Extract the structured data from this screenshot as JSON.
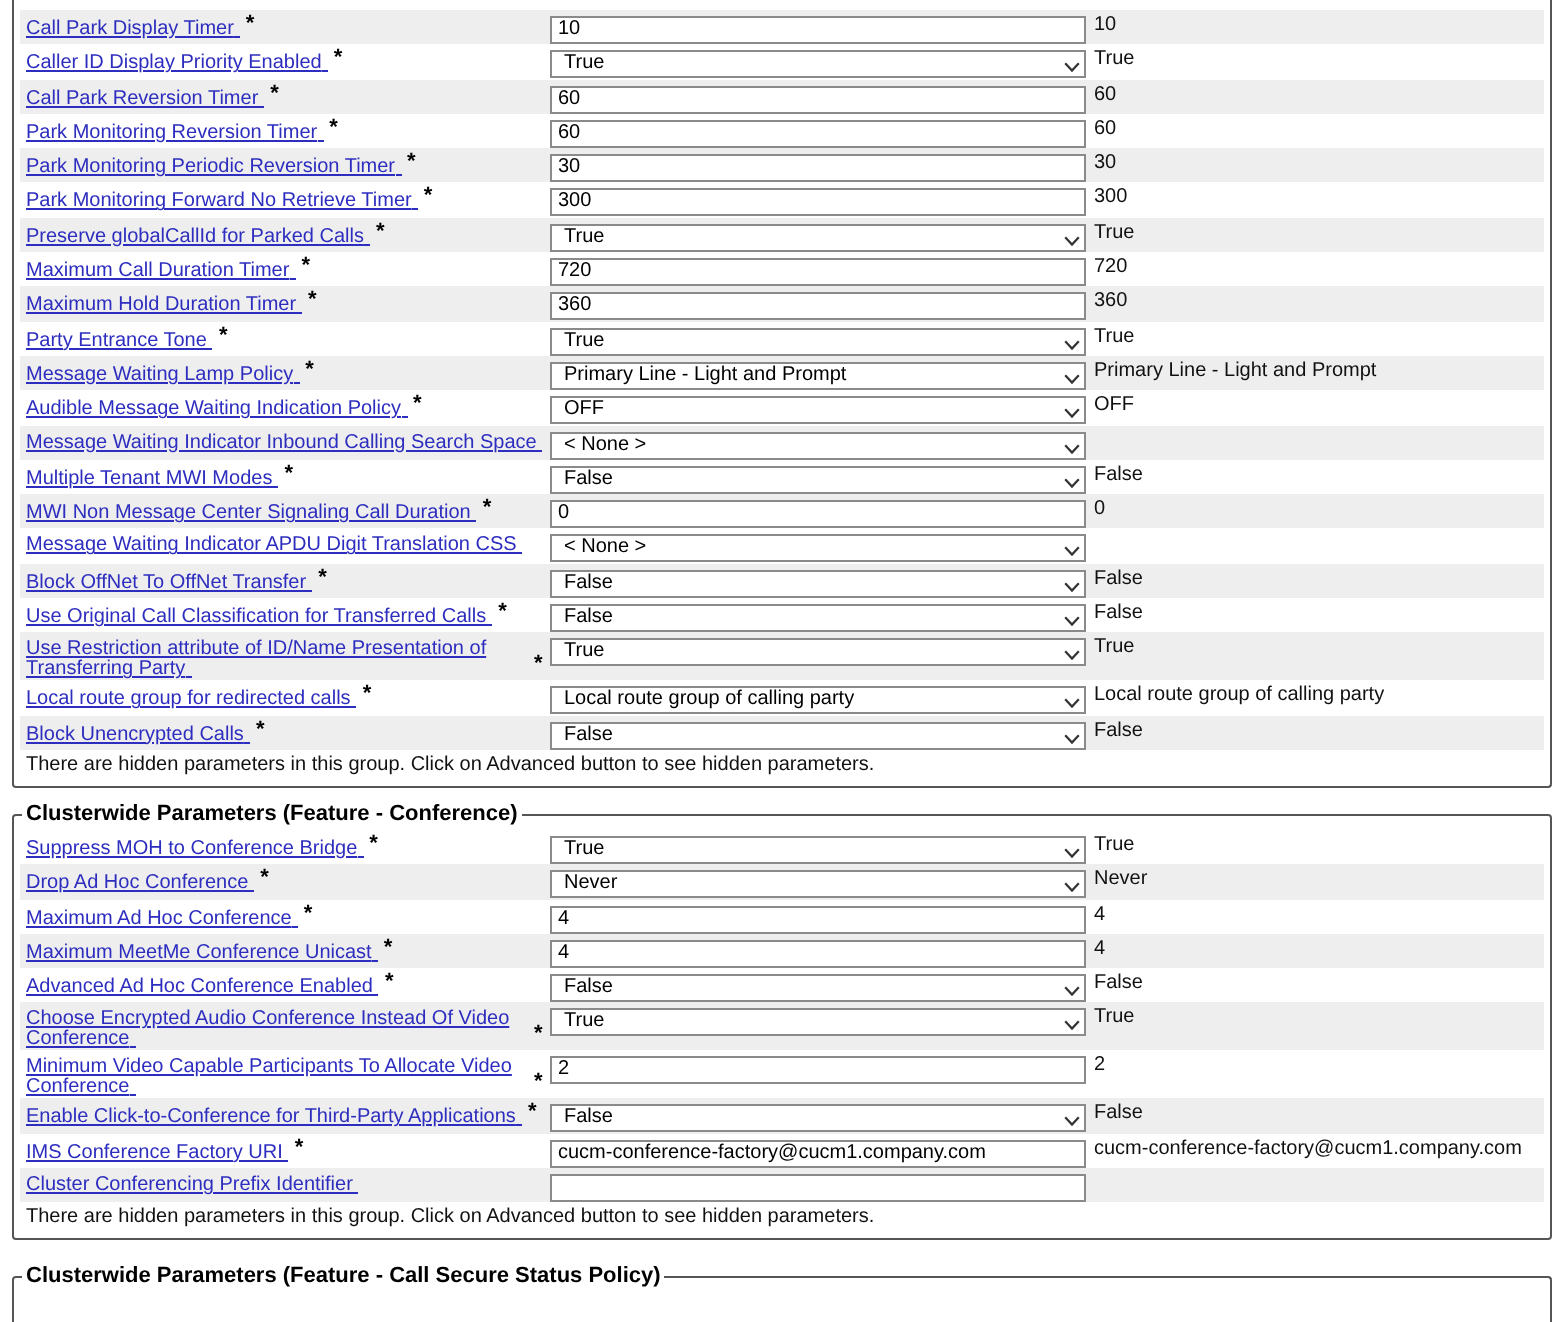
{
  "sections": [
    {
      "rows": [
        {
          "label": "Call Park Display Timer",
          "required_mark": "*",
          "field": {
            "kind": "text",
            "value": "10"
          },
          "column_3": "10"
        },
        {
          "label": "Caller ID Display Priority Enabled",
          "required_mark": "*",
          "field": {
            "kind": "select",
            "value": "True"
          },
          "column_3": "True"
        },
        {
          "label": "Call Park Reversion Timer",
          "required_mark": "*",
          "field": {
            "kind": "text",
            "value": "60"
          },
          "column_3": "60"
        },
        {
          "label": "Park Monitoring Reversion Timer",
          "required_mark": "*",
          "field": {
            "kind": "text",
            "value": "60"
          },
          "column_3": "60"
        },
        {
          "label": "Park Monitoring Periodic Reversion Timer",
          "required_mark": "*",
          "field": {
            "kind": "text",
            "value": "30"
          },
          "column_3": "30"
        },
        {
          "label": "Park Monitoring Forward No Retrieve Timer",
          "required_mark": "*",
          "field": {
            "kind": "text",
            "value": "300"
          },
          "column_3": "300"
        },
        {
          "label": "Preserve globalCallId for Parked Calls",
          "required_mark": "*",
          "field": {
            "kind": "select",
            "value": "True"
          },
          "column_3": "True"
        },
        {
          "label": "Maximum Call Duration Timer",
          "required_mark": "*",
          "field": {
            "kind": "text",
            "value": "720"
          },
          "column_3": "720"
        },
        {
          "label": "Maximum Hold Duration Timer",
          "required_mark": "*",
          "field": {
            "kind": "text",
            "value": "360"
          },
          "column_3": "360"
        },
        {
          "label": "Party Entrance Tone",
          "required_mark": "*",
          "field": {
            "kind": "select",
            "value": "True"
          },
          "column_3": "True"
        },
        {
          "label": "Message Waiting Lamp Policy",
          "required_mark": "*",
          "field": {
            "kind": "select",
            "value": "Primary Line - Light and Prompt"
          },
          "column_3": "Primary Line - Light and Prompt"
        },
        {
          "label": "Audible Message Waiting Indication Policy",
          "required_mark": "*",
          "field": {
            "kind": "select",
            "value": "OFF"
          },
          "column_3": "OFF"
        },
        {
          "label": "Message Waiting Indicator Inbound Calling Search Space",
          "field": {
            "kind": "select",
            "value": "< None >"
          }
        },
        {
          "label": "Multiple Tenant MWI Modes",
          "required_mark": "*",
          "field": {
            "kind": "select",
            "value": "False"
          },
          "column_3": "False"
        },
        {
          "label": "MWI Non Message Center Signaling Call Duration",
          "required_mark": "*",
          "field": {
            "kind": "text",
            "value": "0"
          },
          "column_3": "0"
        },
        {
          "label": "Message Waiting Indicator APDU Digit Translation CSS",
          "field": {
            "kind": "select",
            "value": "< None >"
          }
        },
        {
          "label": "Block OffNet To OffNet Transfer",
          "required_mark": "*",
          "field": {
            "kind": "select",
            "value": "False"
          },
          "column_3": "False"
        },
        {
          "label": "Use Original Call Classification for Transferred Calls",
          "required_mark": "*",
          "field": {
            "kind": "select",
            "value": "False"
          },
          "column_3": "False"
        },
        {
          "label": "Use Restriction attribute of ID/Name Presentation of Transferring Party",
          "required_mark": "*",
          "field": {
            "kind": "select",
            "value": "True"
          },
          "column_3": "True"
        },
        {
          "label": "Local route group for redirected calls",
          "required_mark": "*",
          "field": {
            "kind": "select",
            "value": "Local route group of calling party"
          },
          "column_3": "Local route group of calling party"
        },
        {
          "label": "Block Unencrypted Calls",
          "required_mark": "*",
          "field": {
            "kind": "select",
            "value": "False"
          },
          "column_3": "False"
        }
      ],
      "note": "There are hidden parameters in this group. Click on Advanced button to see hidden parameters."
    },
    {
      "legend": "Clusterwide Parameters (Feature - Conference)",
      "rows": [
        {
          "label": "Suppress MOH to Conference Bridge",
          "required_mark": "*",
          "field": {
            "kind": "select",
            "value": "True"
          },
          "column_3": "True"
        },
        {
          "label": "Drop Ad Hoc Conference",
          "required_mark": "*",
          "field": {
            "kind": "select",
            "value": "Never"
          },
          "column_3": "Never"
        },
        {
          "label": "Maximum Ad Hoc Conference",
          "required_mark": "*",
          "field": {
            "kind": "text",
            "value": "4"
          },
          "column_3": "4"
        },
        {
          "label": "Maximum MeetMe Conference Unicast",
          "required_mark": "*",
          "field": {
            "kind": "text",
            "value": "4"
          },
          "column_3": "4"
        },
        {
          "label": "Advanced Ad Hoc Conference Enabled",
          "required_mark": "*",
          "field": {
            "kind": "select",
            "value": "False"
          },
          "column_3": "False"
        },
        {
          "label": "Choose Encrypted Audio Conference Instead Of Video Conference",
          "required_mark": "*",
          "field": {
            "kind": "select",
            "value": "True"
          },
          "column_3": "True"
        },
        {
          "label": "Minimum Video Capable Participants To Allocate Video Conference",
          "required_mark": "*",
          "field": {
            "kind": "text",
            "value": "2"
          },
          "column_3": "2"
        },
        {
          "label": "Enable Click-to-Conference for Third-Party Applications",
          "required_mark": "*",
          "field": {
            "kind": "select",
            "value": "False"
          },
          "column_3": "False"
        },
        {
          "label": "IMS Conference Factory URI",
          "required_mark": "*",
          "field": {
            "kind": "text",
            "value": "cucm-conference-factory@cucm1.company.com"
          },
          "column_3": "cucm-conference-factory@cucm1.company.com"
        },
        {
          "label": "Cluster Conferencing Prefix Identifier",
          "field": {
            "kind": "text"
          }
        }
      ],
      "note": "There are hidden parameters in this group. Click on Advanced button to see hidden parameters."
    },
    {
      "legend": "Clusterwide Parameters (Feature - Call Secure Status Policy)"
    }
  ]
}
